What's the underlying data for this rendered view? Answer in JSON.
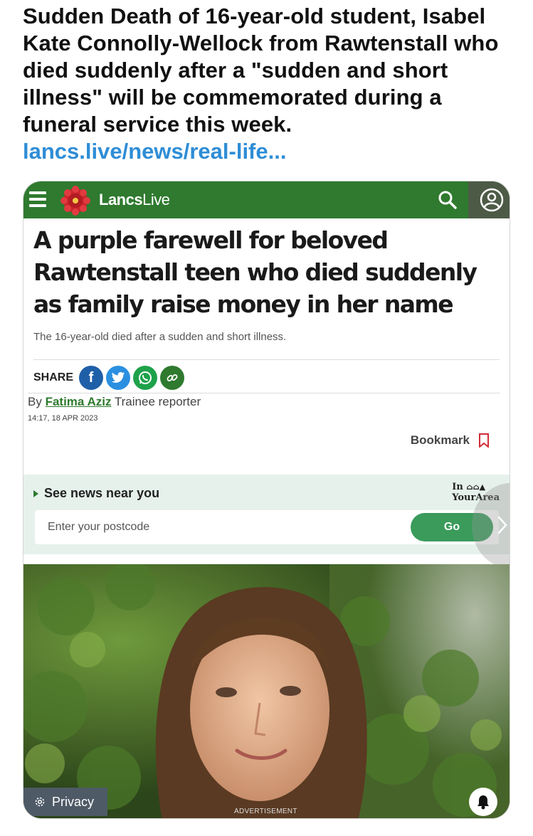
{
  "tweet": {
    "text": "Sudden Death of 16-year-old student, Isabel Kate Connolly-Wellock from Rawtenstall who died suddenly after a \"sudden and short illness\" will be commemorated during a funeral service this week.",
    "link": "lancs.live/news/real-life..."
  },
  "site": {
    "brand_bold": "Lancs",
    "brand_light": "Live",
    "header_color": "#2f7a2f"
  },
  "article": {
    "headline": "A purple farewell for beloved Rawtenstall teen who died suddenly as family raise money in her name",
    "subhead": "The 16-year-old died after a sudden and short illness.",
    "share_label": "SHARE",
    "by_prefix": "By",
    "author": "Fatima Aziz",
    "author_role": "Trainee reporter",
    "datetime": "14:17, 18 APR 2023",
    "bookmark_label": "Bookmark"
  },
  "near_you": {
    "title": "See news near you",
    "brand_line1": "In",
    "brand_line2": "YourArea",
    "placeholder": "Enter your postcode",
    "go_label": "Go"
  },
  "footer": {
    "privacy_label": "Privacy",
    "ad_label": "ADVERTISEMENT"
  },
  "icons": [
    "menu-icon",
    "rose-icon",
    "search-icon",
    "user-icon",
    "facebook-icon",
    "twitter-icon",
    "whatsapp-icon",
    "link-icon",
    "bookmark-icon",
    "chevron-right-icon",
    "gear-icon",
    "bell-icon"
  ]
}
